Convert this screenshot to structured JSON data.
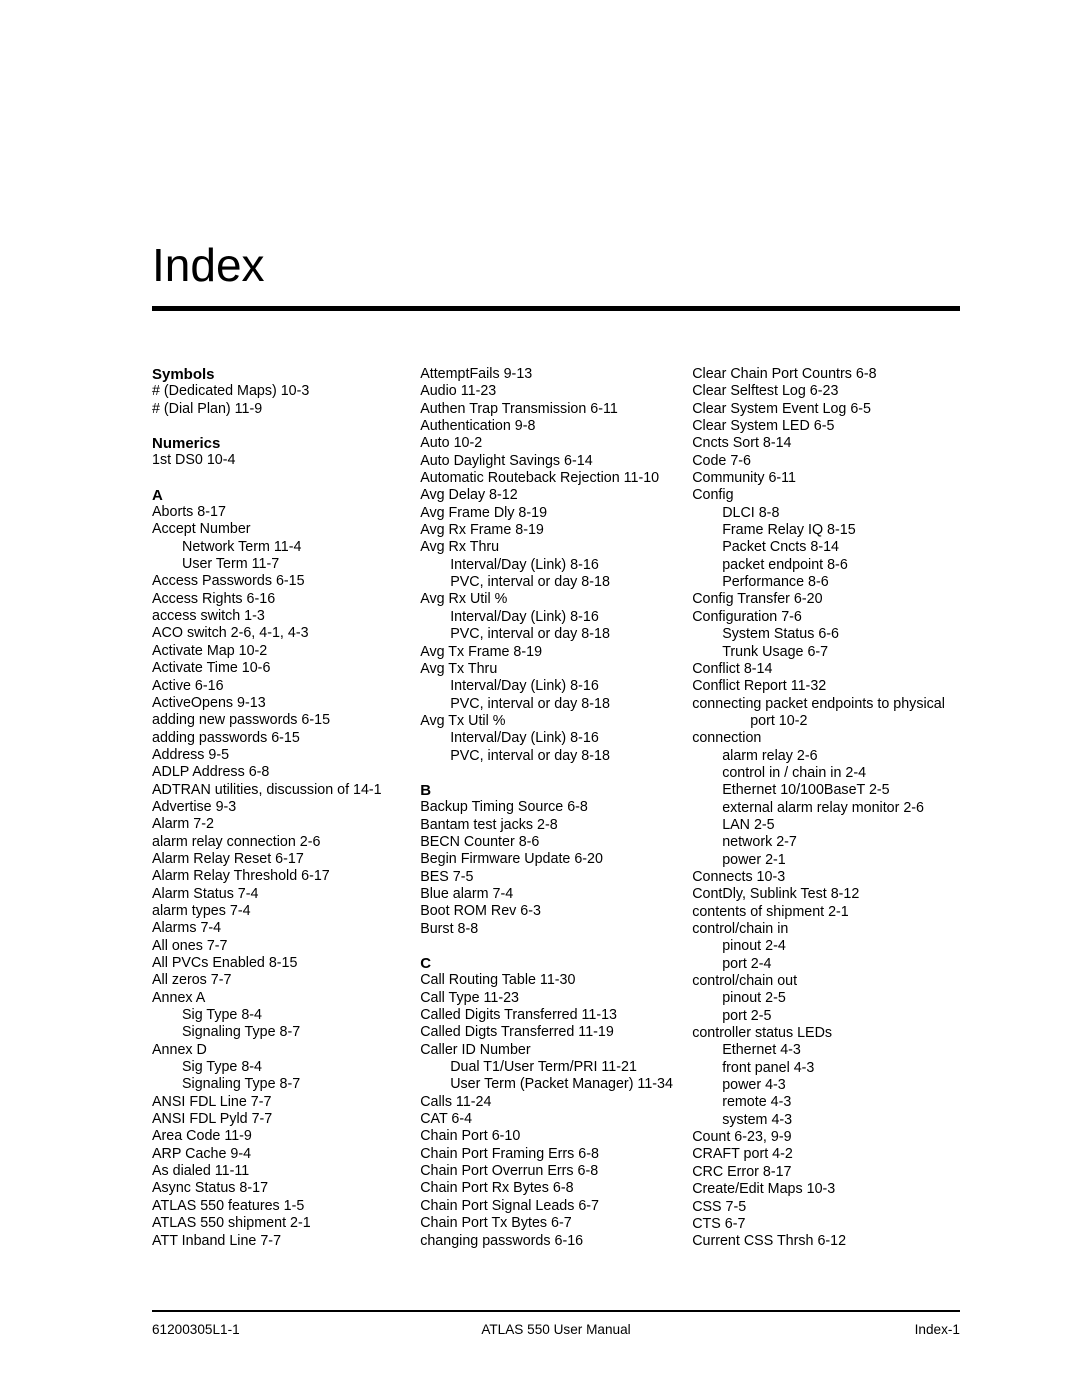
{
  "document": {
    "title": "Index"
  },
  "footer": {
    "left": "61200305L1-1",
    "center": "ATLAS 550 User Manual",
    "right": "Index-1"
  },
  "columns": [
    {
      "id": "column-1",
      "blocks": [
        {
          "type": "head",
          "text": "Symbols"
        },
        {
          "type": "entry",
          "level": 0,
          "text": "# (Dedicated Maps)  10-3"
        },
        {
          "type": "entry",
          "level": 0,
          "text": "# (Dial Plan)  11-9"
        },
        {
          "type": "head",
          "text": "Numerics",
          "spaced": true
        },
        {
          "type": "entry",
          "level": 0,
          "text": "1st DS0  10-4"
        },
        {
          "type": "head",
          "text": "A",
          "spaced": true
        },
        {
          "type": "entry",
          "level": 0,
          "text": "Aborts  8-17"
        },
        {
          "type": "entry",
          "level": 0,
          "text": "Accept Number"
        },
        {
          "type": "entry",
          "level": 1,
          "text": "Network Term  11-4"
        },
        {
          "type": "entry",
          "level": 1,
          "text": "User Term  11-7"
        },
        {
          "type": "entry",
          "level": 0,
          "text": "Access Passwords  6-15"
        },
        {
          "type": "entry",
          "level": 0,
          "text": "Access Rights  6-16"
        },
        {
          "type": "entry",
          "level": 0,
          "text": "access switch  1-3"
        },
        {
          "type": "entry",
          "level": 0,
          "text": "ACO switch  2-6,  4-1,  4-3"
        },
        {
          "type": "entry",
          "level": 0,
          "text": "Activate Map  10-2"
        },
        {
          "type": "entry",
          "level": 0,
          "text": "Activate Time  10-6"
        },
        {
          "type": "entry",
          "level": 0,
          "text": "Active  6-16"
        },
        {
          "type": "entry",
          "level": 0,
          "text": "ActiveOpens  9-13"
        },
        {
          "type": "entry",
          "level": 0,
          "text": "adding new passwords  6-15"
        },
        {
          "type": "entry",
          "level": 0,
          "text": "adding passwords  6-15"
        },
        {
          "type": "entry",
          "level": 0,
          "text": "Address  9-5"
        },
        {
          "type": "entry",
          "level": 0,
          "text": "ADLP Address  6-8"
        },
        {
          "type": "entry",
          "level": 0,
          "text": "ADTRAN utilities, discussion of  14-1"
        },
        {
          "type": "entry",
          "level": 0,
          "text": "Advertise  9-3"
        },
        {
          "type": "entry",
          "level": 0,
          "text": "Alarm  7-2"
        },
        {
          "type": "entry",
          "level": 0,
          "text": "alarm relay connection  2-6"
        },
        {
          "type": "entry",
          "level": 0,
          "text": "Alarm Relay Reset  6-17"
        },
        {
          "type": "entry",
          "level": 0,
          "text": "Alarm Relay Threshold  6-17"
        },
        {
          "type": "entry",
          "level": 0,
          "text": "Alarm Status  7-4"
        },
        {
          "type": "entry",
          "level": 0,
          "text": "alarm types  7-4"
        },
        {
          "type": "entry",
          "level": 0,
          "text": "Alarms  7-4"
        },
        {
          "type": "entry",
          "level": 0,
          "text": "All ones  7-7"
        },
        {
          "type": "entry",
          "level": 0,
          "text": "All PVCs Enabled  8-15"
        },
        {
          "type": "entry",
          "level": 0,
          "text": "All zeros  7-7"
        },
        {
          "type": "entry",
          "level": 0,
          "text": "Annex A"
        },
        {
          "type": "entry",
          "level": 1,
          "text": "Sig Type  8-4"
        },
        {
          "type": "entry",
          "level": 1,
          "text": "Signaling Type  8-7"
        },
        {
          "type": "entry",
          "level": 0,
          "text": "Annex D"
        },
        {
          "type": "entry",
          "level": 1,
          "text": "Sig Type  8-4"
        },
        {
          "type": "entry",
          "level": 1,
          "text": "Signaling Type  8-7"
        },
        {
          "type": "entry",
          "level": 0,
          "text": "ANSI FDL Line  7-7"
        },
        {
          "type": "entry",
          "level": 0,
          "text": "ANSI FDL Pyld  7-7"
        },
        {
          "type": "entry",
          "level": 0,
          "text": "Area Code  11-9"
        },
        {
          "type": "entry",
          "level": 0,
          "text": "ARP Cache  9-4"
        },
        {
          "type": "entry",
          "level": 0,
          "text": "As dialed  11-11"
        },
        {
          "type": "entry",
          "level": 0,
          "text": "Async Status  8-17"
        },
        {
          "type": "entry",
          "level": 0,
          "text": "ATLAS 550 features  1-5"
        },
        {
          "type": "entry",
          "level": 0,
          "text": "ATLAS 550 shipment  2-1"
        },
        {
          "type": "entry",
          "level": 0,
          "text": "ATT Inband Line  7-7"
        }
      ]
    },
    {
      "id": "column-2",
      "blocks": [
        {
          "type": "entry",
          "level": 0,
          "text": "AttemptFails  9-13"
        },
        {
          "type": "entry",
          "level": 0,
          "text": "Audio  11-23"
        },
        {
          "type": "entry",
          "level": 0,
          "text": "Authen Trap Transmission  6-11"
        },
        {
          "type": "entry",
          "level": 0,
          "text": "Authentication  9-8"
        },
        {
          "type": "entry",
          "level": 0,
          "text": "Auto  10-2"
        },
        {
          "type": "entry",
          "level": 0,
          "text": "Auto Daylight Savings  6-14"
        },
        {
          "type": "entry",
          "level": 0,
          "text": "Automatic Routeback Rejection  11-10"
        },
        {
          "type": "entry",
          "level": 0,
          "text": "Avg Delay  8-12"
        },
        {
          "type": "entry",
          "level": 0,
          "text": "Avg Frame Dly  8-19"
        },
        {
          "type": "entry",
          "level": 0,
          "text": "Avg Rx Frame  8-19"
        },
        {
          "type": "entry",
          "level": 0,
          "text": "Avg Rx Thru"
        },
        {
          "type": "entry",
          "level": 1,
          "text": "Interval/Day (Link)  8-16"
        },
        {
          "type": "entry",
          "level": 1,
          "text": "PVC, interval or day  8-18"
        },
        {
          "type": "entry",
          "level": 0,
          "text": "Avg Rx Util %"
        },
        {
          "type": "entry",
          "level": 1,
          "text": "Interval/Day (Link)  8-16"
        },
        {
          "type": "entry",
          "level": 1,
          "text": "PVC, interval or day  8-18"
        },
        {
          "type": "entry",
          "level": 0,
          "text": "Avg Tx Frame  8-19"
        },
        {
          "type": "entry",
          "level": 0,
          "text": "Avg Tx Thru"
        },
        {
          "type": "entry",
          "level": 1,
          "text": "Interval/Day (Link)  8-16"
        },
        {
          "type": "entry",
          "level": 1,
          "text": "PVC, interval or day  8-18"
        },
        {
          "type": "entry",
          "level": 0,
          "text": "Avg Tx Util %"
        },
        {
          "type": "entry",
          "level": 1,
          "text": "Interval/Day (Link)  8-16"
        },
        {
          "type": "entry",
          "level": 1,
          "text": "PVC, interval or day  8-18"
        },
        {
          "type": "head",
          "text": "B",
          "spaced": true
        },
        {
          "type": "entry",
          "level": 0,
          "text": "Backup Timing Source  6-8"
        },
        {
          "type": "entry",
          "level": 0,
          "text": "Bantam test jacks  2-8"
        },
        {
          "type": "entry",
          "level": 0,
          "text": "BECN Counter  8-6"
        },
        {
          "type": "entry",
          "level": 0,
          "text": "Begin Firmware Update  6-20"
        },
        {
          "type": "entry",
          "level": 0,
          "text": "BES  7-5"
        },
        {
          "type": "entry",
          "level": 0,
          "text": "Blue alarm  7-4"
        },
        {
          "type": "entry",
          "level": 0,
          "text": "Boot ROM Rev  6-3"
        },
        {
          "type": "entry",
          "level": 0,
          "text": "Burst  8-8"
        },
        {
          "type": "head",
          "text": "C",
          "spaced": true
        },
        {
          "type": "entry",
          "level": 0,
          "text": "Call Routing Table  11-30"
        },
        {
          "type": "entry",
          "level": 0,
          "text": "Call Type  11-23"
        },
        {
          "type": "entry",
          "level": 0,
          "text": "Called Digits Transferred  11-13"
        },
        {
          "type": "entry",
          "level": 0,
          "text": "Called Digts Transferred  11-19"
        },
        {
          "type": "entry",
          "level": 0,
          "text": "Caller ID Number"
        },
        {
          "type": "entry",
          "level": 1,
          "text": "Dual T1/User Term/PRI  11-21"
        },
        {
          "type": "entry",
          "level": 1,
          "text": "User Term (Packet Manager)  11-34"
        },
        {
          "type": "entry",
          "level": 0,
          "text": "Calls  11-24"
        },
        {
          "type": "entry",
          "level": 0,
          "text": "CAT  6-4"
        },
        {
          "type": "entry",
          "level": 0,
          "text": "Chain Port  6-10"
        },
        {
          "type": "entry",
          "level": 0,
          "text": "Chain Port Framing Errs  6-8"
        },
        {
          "type": "entry",
          "level": 0,
          "text": "Chain Port Overrun Errs  6-8"
        },
        {
          "type": "entry",
          "level": 0,
          "text": "Chain Port Rx Bytes  6-8"
        },
        {
          "type": "entry",
          "level": 0,
          "text": "Chain Port Signal Leads  6-7"
        },
        {
          "type": "entry",
          "level": 0,
          "text": "Chain Port Tx Bytes  6-7"
        },
        {
          "type": "entry",
          "level": 0,
          "text": "changing passwords  6-16"
        }
      ]
    },
    {
      "id": "column-3",
      "blocks": [
        {
          "type": "entry",
          "level": 0,
          "text": "Clear Chain Port Countrs  6-8"
        },
        {
          "type": "entry",
          "level": 0,
          "text": "Clear Selftest Log  6-23"
        },
        {
          "type": "entry",
          "level": 0,
          "text": "Clear System Event Log  6-5"
        },
        {
          "type": "entry",
          "level": 0,
          "text": "Clear System LED  6-5"
        },
        {
          "type": "entry",
          "level": 0,
          "text": "Cncts Sort  8-14"
        },
        {
          "type": "entry",
          "level": 0,
          "text": "Code  7-6"
        },
        {
          "type": "entry",
          "level": 0,
          "text": "Community  6-11"
        },
        {
          "type": "entry",
          "level": 0,
          "text": "Config"
        },
        {
          "type": "entry",
          "level": 1,
          "text": "DLCI  8-8"
        },
        {
          "type": "entry",
          "level": 1,
          "text": "Frame Relay IQ  8-15"
        },
        {
          "type": "entry",
          "level": 1,
          "text": "Packet Cncts  8-14"
        },
        {
          "type": "entry",
          "level": 1,
          "text": "packet endpoint  8-6"
        },
        {
          "type": "entry",
          "level": 1,
          "text": "Performance  8-6"
        },
        {
          "type": "entry",
          "level": 0,
          "text": "Config Transfer  6-20"
        },
        {
          "type": "entry",
          "level": 0,
          "text": "Configuration  7-6"
        },
        {
          "type": "entry",
          "level": 1,
          "text": "System Status  6-6"
        },
        {
          "type": "entry",
          "level": 1,
          "text": "Trunk Usage  6-7"
        },
        {
          "type": "entry",
          "level": 0,
          "text": "Conflict  8-14"
        },
        {
          "type": "entry",
          "level": 0,
          "text": "Conflict Report  11-32"
        },
        {
          "type": "entry",
          "level": 0,
          "text": "connecting packet endpoints to physical"
        },
        {
          "type": "entry",
          "level": 2,
          "text": "port  10-2"
        },
        {
          "type": "entry",
          "level": 0,
          "text": "connection"
        },
        {
          "type": "entry",
          "level": 1,
          "text": "alarm relay  2-6"
        },
        {
          "type": "entry",
          "level": 1,
          "text": "control in / chain in  2-4"
        },
        {
          "type": "entry",
          "level": 1,
          "text": "Ethernet 10/100BaseT  2-5"
        },
        {
          "type": "entry",
          "level": 1,
          "text": "external alarm relay monitor  2-6"
        },
        {
          "type": "entry",
          "level": 1,
          "text": "LAN  2-5"
        },
        {
          "type": "entry",
          "level": 1,
          "text": "network  2-7"
        },
        {
          "type": "entry",
          "level": 1,
          "text": "power  2-1"
        },
        {
          "type": "entry",
          "level": 0,
          "text": "Connects  10-3"
        },
        {
          "type": "entry",
          "level": 0,
          "text": "ContDly, Sublink Test  8-12"
        },
        {
          "type": "entry",
          "level": 0,
          "text": "contents of shipment  2-1"
        },
        {
          "type": "entry",
          "level": 0,
          "text": "control/chain in"
        },
        {
          "type": "entry",
          "level": 1,
          "text": "pinout  2-4"
        },
        {
          "type": "entry",
          "level": 1,
          "text": "port  2-4"
        },
        {
          "type": "entry",
          "level": 0,
          "text": "control/chain out"
        },
        {
          "type": "entry",
          "level": 1,
          "text": "pinout  2-5"
        },
        {
          "type": "entry",
          "level": 1,
          "text": "port  2-5"
        },
        {
          "type": "entry",
          "level": 0,
          "text": "controller status LEDs"
        },
        {
          "type": "entry",
          "level": 1,
          "text": "Ethernet  4-3"
        },
        {
          "type": "entry",
          "level": 1,
          "text": "front panel  4-3"
        },
        {
          "type": "entry",
          "level": 1,
          "text": "power  4-3"
        },
        {
          "type": "entry",
          "level": 1,
          "text": "remote  4-3"
        },
        {
          "type": "entry",
          "level": 1,
          "text": "system  4-3"
        },
        {
          "type": "entry",
          "level": 0,
          "text": "Count  6-23,  9-9"
        },
        {
          "type": "entry",
          "level": 0,
          "text": "CRAFT port  4-2"
        },
        {
          "type": "entry",
          "level": 0,
          "text": "CRC Error  8-17"
        },
        {
          "type": "entry",
          "level": 0,
          "text": "Create/Edit Maps  10-3"
        },
        {
          "type": "entry",
          "level": 0,
          "text": "CSS  7-5"
        },
        {
          "type": "entry",
          "level": 0,
          "text": "CTS  6-7"
        },
        {
          "type": "entry",
          "level": 0,
          "text": "Current CSS Thrsh  6-12"
        }
      ]
    }
  ]
}
